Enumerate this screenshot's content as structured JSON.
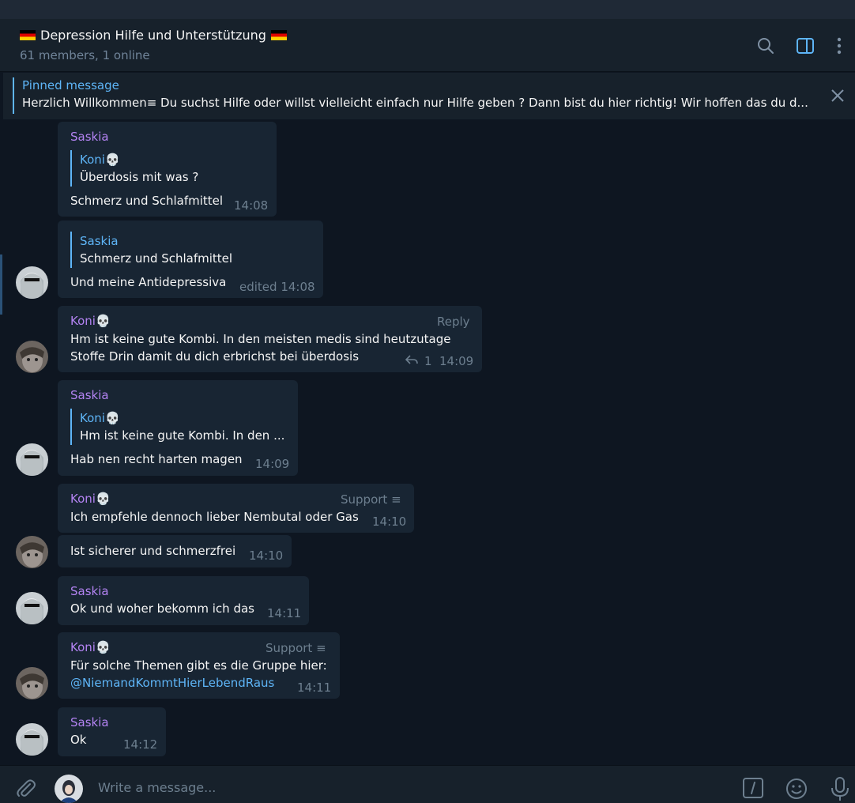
{
  "header": {
    "title": "Depression Hilfe und Unterstützung",
    "subtitle": "61 members, 1 online"
  },
  "pinned": {
    "label": "Pinned message",
    "text": "Herzlich Willkommen≡  Du suchst Hilfe oder willst vielleicht einfach nur Hilfe geben ? Dann bist du hier richtig! Wir hoffen das du d..."
  },
  "messages": [
    {
      "sender": "Saskia",
      "reply_to": {
        "name": "Koni💀",
        "text": "Überdosis mit was ?"
      },
      "text": "Schmerz und Schlafmittel",
      "time": "14:08"
    },
    {
      "reply_to": {
        "name": "Saskia",
        "text": "Schmerz und Schlafmittel"
      },
      "text": "Und meine Antidepressiva",
      "time": "edited 14:08"
    },
    {
      "sender": "Koni💀",
      "action": "Reply",
      "text_line1": "Hm ist keine gute Kombi. In den meisten medis sind heutzutage",
      "text_line2": "Stoffe Drin damit du dich erbrichst bei überdosis",
      "replies": "1",
      "time": "14:09"
    },
    {
      "sender": "Saskia",
      "reply_to": {
        "name": "Koni💀",
        "text": "Hm ist keine gute Kombi. In den ..."
      },
      "text": "Hab nen recht harten magen",
      "time": "14:09"
    },
    {
      "sender": "Koni💀",
      "badge": "Support ≡",
      "text": "Ich empfehle dennoch lieber Nembutal oder Gas",
      "time": "14:10"
    },
    {
      "text": "Ist sicherer und schmerzfrei",
      "time": "14:10"
    },
    {
      "sender": "Saskia",
      "text": "Ok und woher bekomm ich das",
      "time": "14:11"
    },
    {
      "sender": "Koni💀",
      "badge": "Support ≡",
      "text": "Für solche Themen gibt es die Gruppe hier:",
      "link": "@NiemandKommtHierLebendRaus",
      "time": "14:11"
    },
    {
      "sender": "Saskia",
      "text": "Ok",
      "time": "14:12"
    }
  ],
  "composer": {
    "placeholder": "Write a message..."
  },
  "colors": {
    "background": "#0e1621",
    "bubble": "#182533",
    "accent": "#5eb5f7",
    "sender": "#b383f2"
  }
}
